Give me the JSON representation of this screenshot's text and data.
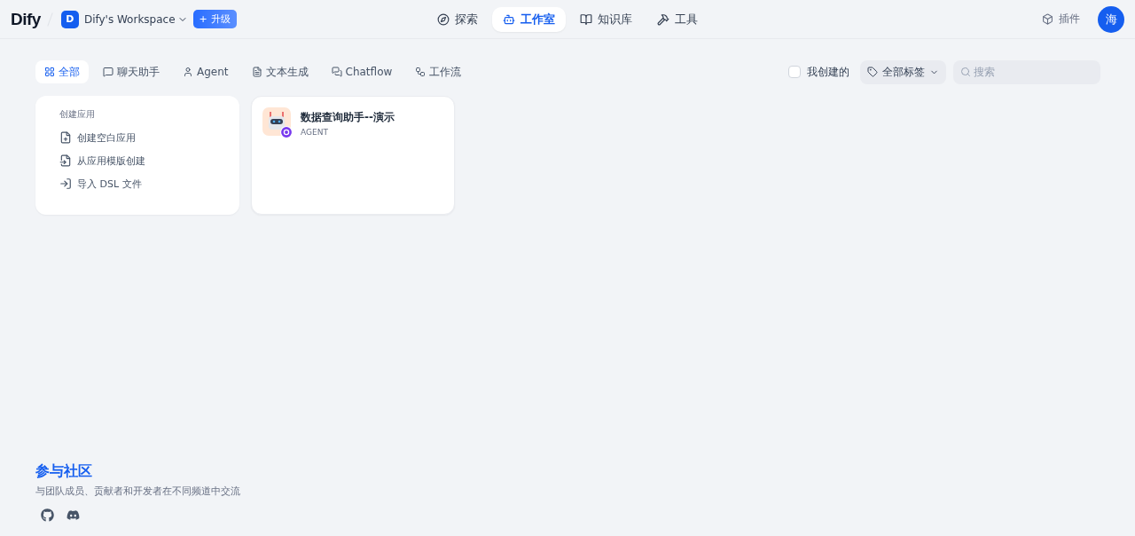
{
  "header": {
    "logo": "Dify",
    "workspace": {
      "initial": "D",
      "name": "Dify's Workspace"
    },
    "upgrade": {
      "icon": "+",
      "label": "升级"
    },
    "nav": [
      {
        "label": "探索",
        "selected": false
      },
      {
        "label": "工作室",
        "selected": true
      },
      {
        "label": "知识库",
        "selected": false
      },
      {
        "label": "工具",
        "selected": false
      }
    ],
    "plugins": "插件",
    "avatar": "海"
  },
  "filters": {
    "tabs": [
      {
        "label": "全部",
        "selected": true
      },
      {
        "label": "聊天助手",
        "selected": false
      },
      {
        "label": "Agent",
        "selected": false
      },
      {
        "label": "文本生成",
        "selected": false
      },
      {
        "label": "Chatflow",
        "selected": false
      },
      {
        "label": "工作流",
        "selected": false
      }
    ],
    "mine": {
      "label": "我创建的",
      "checked": false
    },
    "tags": "全部标签",
    "search": {
      "placeholder": "搜索"
    }
  },
  "create_card": {
    "title": "创建应用",
    "actions": [
      "创建空白应用",
      "从应用模版创建",
      "导入 DSL 文件"
    ]
  },
  "apps": [
    {
      "name": "数据查询助手--演示",
      "type": "AGENT"
    }
  ],
  "community": {
    "title": "参与社区",
    "subtitle": "与团队成员、贡献者和开发者在不同频道中交流"
  }
}
